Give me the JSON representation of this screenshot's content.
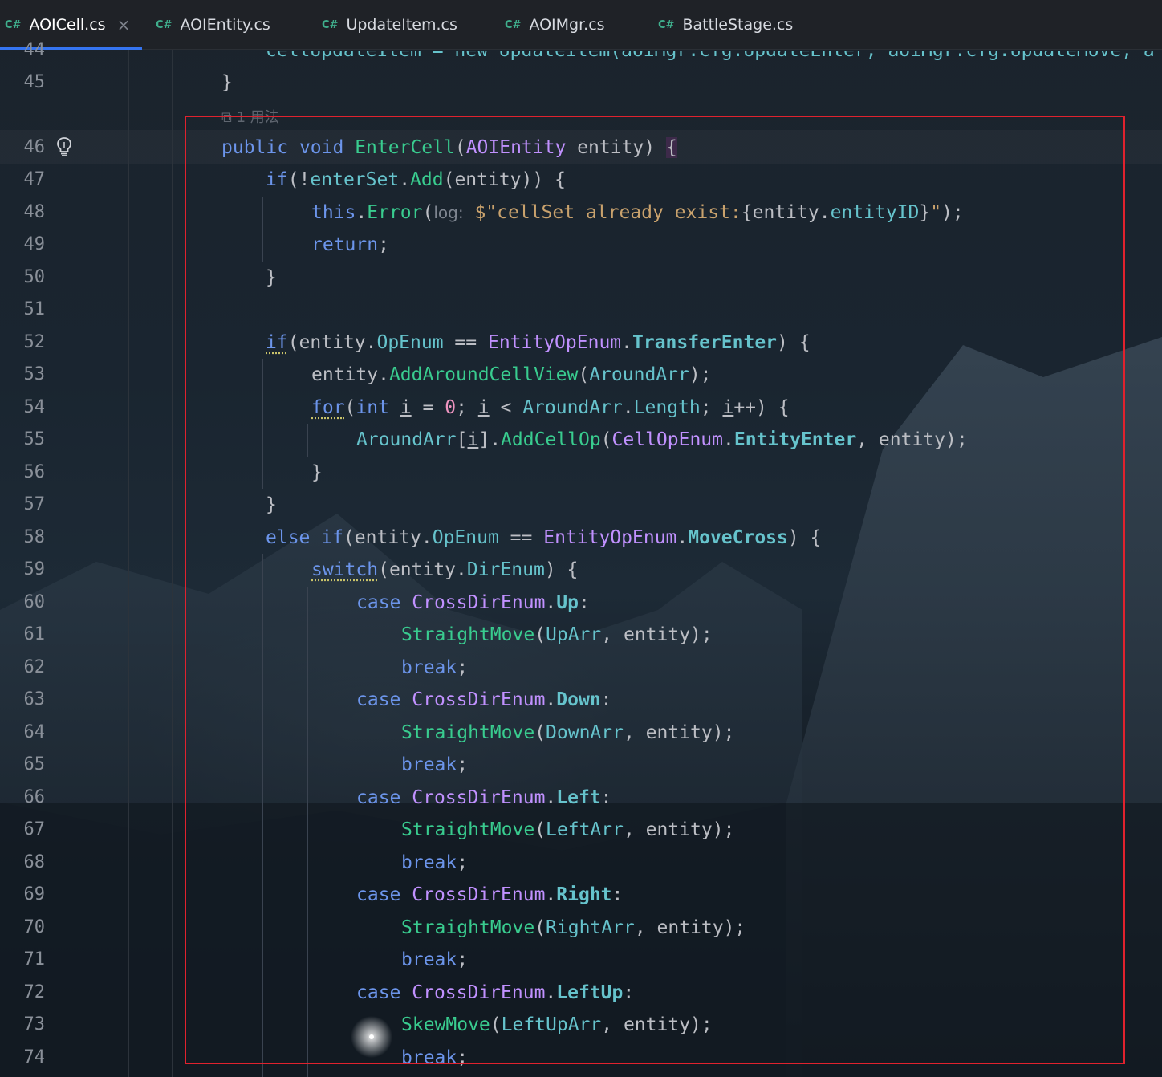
{
  "tabs": [
    {
      "lang": "C#",
      "label": "AOICell.cs",
      "close": "×",
      "active": true
    },
    {
      "lang": "C#",
      "label": "AOIEntity.cs"
    },
    {
      "lang": "C#",
      "label": "UpdateItem.cs"
    },
    {
      "lang": "C#",
      "label": "AOIMgr.cs"
    },
    {
      "lang": "C#",
      "label": "BattleStage.cs"
    }
  ],
  "usage_hint": "1 用法",
  "parameter_hint": "log:",
  "icons": {
    "lightbulb": "lightbulb-icon",
    "usage": "usage-icon",
    "close": "close-icon"
  },
  "colors": {
    "keyword": "#6c95eb",
    "method": "#39cc8f",
    "type": "#c191ff",
    "member": "#66c3cc",
    "string": "#c9a26d",
    "number": "#ed94c0",
    "selection": "#e0222e",
    "active_tab": "#3574f0"
  },
  "line_numbers": [
    "44",
    "45",
    "46",
    "47",
    "48",
    "49",
    "50",
    "51",
    "52",
    "53",
    "54",
    "55",
    "56",
    "57",
    "58",
    "59",
    "60",
    "61",
    "62",
    "63",
    "64",
    "65",
    "66",
    "67",
    "68",
    "69",
    "70",
    "71",
    "72",
    "73",
    "74"
  ],
  "code": {
    "l44": "cellUpdateItem = new UpdateItem(aoiMgr.cfg.UpdateEnter, aoiMgr.cfg.UpdateMove, a",
    "l45": "}",
    "l46": "public void EnterCell(AOIEntity entity) {",
    "l47": "if(!enterSet.Add(entity)) {",
    "l48_a": "this.Error(",
    "l48_b": "$\"cellSet already exist:{entity.entityID}\");",
    "l49": "return;",
    "l50": "}",
    "l52": "if(entity.OpEnum == EntityOpEnum.TransferEnter) {",
    "l53": "entity.AddAroundCellView(AroundArr);",
    "l54": "for(int i = 0; i < AroundArr.Length; i++) {",
    "l55": "AroundArr[i].AddCellOp(CellOpEnum.EntityEnter, entity);",
    "l56": "}",
    "l57": "}",
    "l58": "else if(entity.OpEnum == EntityOpEnum.MoveCross) {",
    "l59": "switch(entity.DirEnum) {",
    "l60": "case CrossDirEnum.Up:",
    "l61": "StraightMove(UpArr, entity);",
    "l62": "break;",
    "l63": "case CrossDirEnum.Down:",
    "l64": "StraightMove(DownArr, entity);",
    "l65": "break;",
    "l66": "case CrossDirEnum.Left:",
    "l67": "StraightMove(LeftArr, entity);",
    "l68": "break;",
    "l69": "case CrossDirEnum.Right:",
    "l70": "StraightMove(RightArr, entity);",
    "l71": "break;",
    "l72": "case CrossDirEnum.LeftUp:",
    "l73": "SkewMove(LeftUpArr, entity);",
    "l74": "break;"
  }
}
